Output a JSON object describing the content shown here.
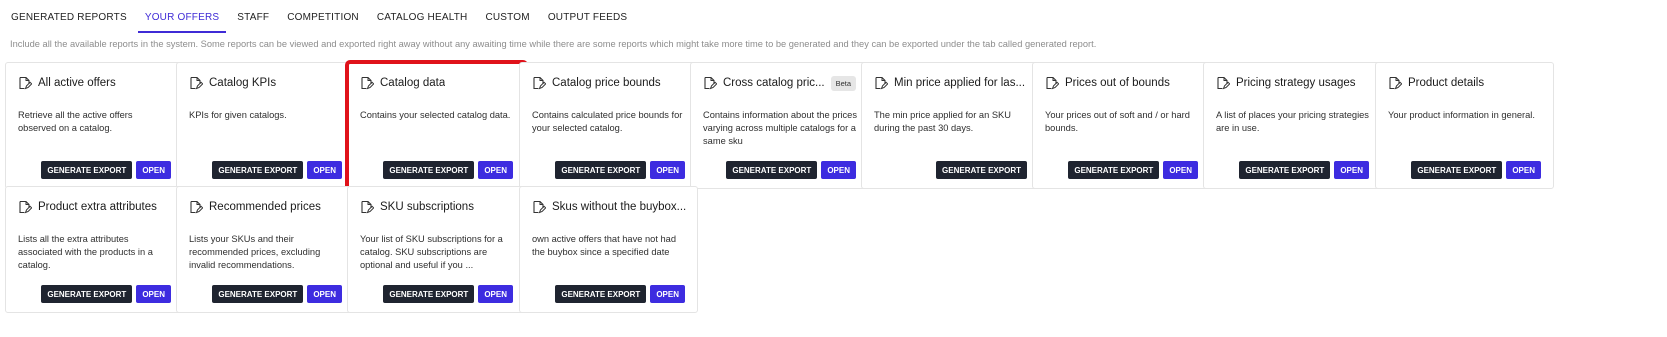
{
  "tabs": [
    {
      "label": "GENERATED REPORTS"
    },
    {
      "label": "YOUR OFFERS"
    },
    {
      "label": "STAFF"
    },
    {
      "label": "COMPETITION"
    },
    {
      "label": "CATALOG HEALTH"
    },
    {
      "label": "CUSTOM"
    },
    {
      "label": "OUTPUT FEEDS"
    }
  ],
  "active_tab": "YOUR OFFERS",
  "description": "Include all the available reports in the system. Some reports can be viewed and exported right away without any awaiting time while there are some reports which might take more time to be generated and they can be exported under the tab called generated report.",
  "cards": [
    {
      "title": "All active offers",
      "description": "Retrieve all the active offers observed on a catalog.",
      "export_label": "GENERATE EXPORT",
      "open_label": "OPEN"
    },
    {
      "title": "Catalog KPIs",
      "description": "KPIs for given catalogs.",
      "export_label": "GENERATE EXPORT",
      "open_label": "OPEN"
    },
    {
      "title": "Catalog data",
      "description": "Contains your selected catalog data.",
      "export_label": "GENERATE EXPORT",
      "open_label": "OPEN"
    },
    {
      "title": "Catalog price bounds",
      "description": "Contains calculated price bounds for your selected catalog.",
      "export_label": "GENERATE EXPORT",
      "open_label": "OPEN"
    },
    {
      "title": "Cross catalog pric...",
      "badge": "Beta",
      "description": "Contains information about the prices varying across multiple catalogs for a same sku",
      "export_label": "GENERATE EXPORT",
      "open_label": "OPEN"
    },
    {
      "title": "Min price applied for las...",
      "description": "The min price applied for an SKU during the past 30 days.",
      "export_label": "GENERATE EXPORT"
    },
    {
      "title": "Prices out of bounds",
      "description": "Your prices out of soft and / or hard bounds.",
      "export_label": "GENERATE EXPORT",
      "open_label": "OPEN"
    },
    {
      "title": "Pricing strategy usages",
      "description": "A list of places your pricing strategies are in use.",
      "export_label": "GENERATE EXPORT",
      "open_label": "OPEN"
    },
    {
      "title": "Product details",
      "description": "Your product information in general.",
      "export_label": "GENERATE EXPORT",
      "open_label": "OPEN"
    },
    {
      "title": "Product extra attributes",
      "description": "Lists all the extra attributes associated with the products in a catalog.",
      "export_label": "GENERATE EXPORT",
      "open_label": "OPEN"
    },
    {
      "title": "Recommended prices",
      "description": "Lists your SKUs and their recommended prices, excluding invalid recommendations.",
      "export_label": "GENERATE EXPORT",
      "open_label": "OPEN"
    },
    {
      "title": "SKU subscriptions",
      "description": "Your list of SKU subscriptions for a catalog. SKU subscriptions are optional and useful if you ...",
      "export_label": "GENERATE EXPORT",
      "open_label": "OPEN"
    },
    {
      "title": "Skus without the buybox...",
      "description": "own active offers that have not had the buybox since a specified date",
      "export_label": "GENERATE EXPORT",
      "open_label": "OPEN"
    }
  ],
  "highlighted_card": "Catalog data",
  "colors": {
    "accent": "#3d2ce0",
    "export_button": "#1f2430",
    "highlight_border": "#e0121a"
  },
  "icons": {
    "card_icon": "edit-document-icon"
  }
}
